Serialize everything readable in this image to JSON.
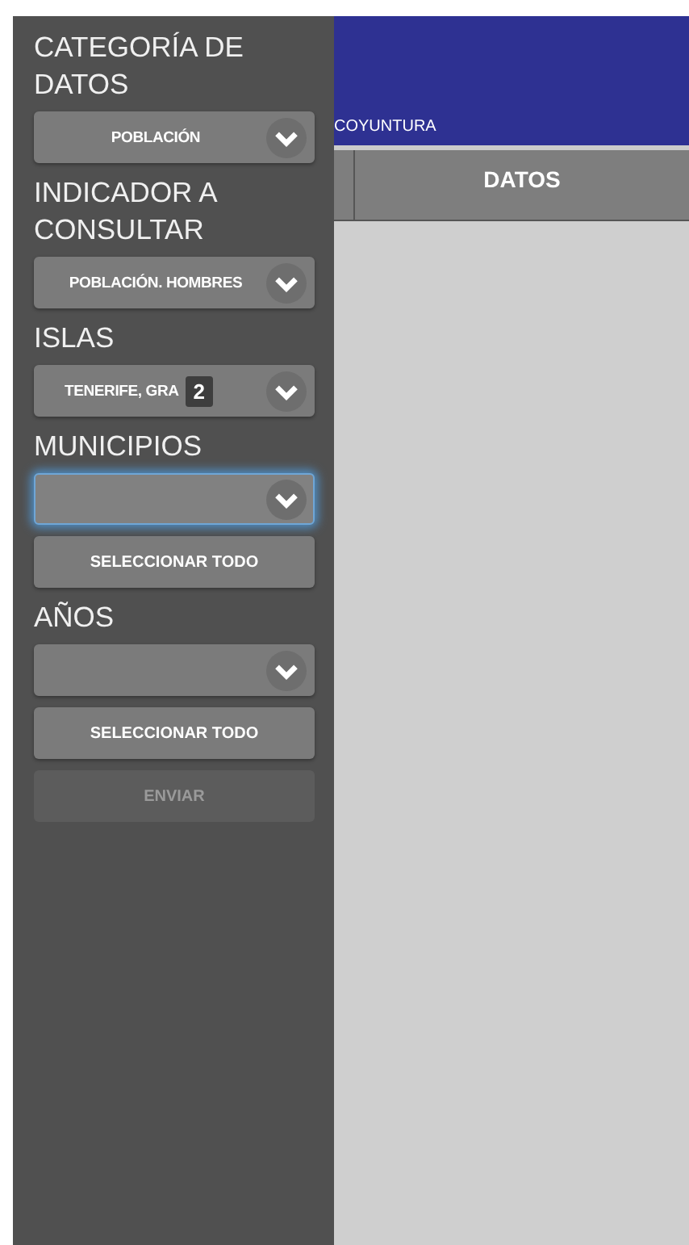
{
  "sidebar": {
    "items": [
      {
        "kind": "label",
        "text": "CATEGORÍA DE DATOS"
      },
      {
        "kind": "select",
        "value": "POBLACIÓN",
        "focused": false
      },
      {
        "kind": "label",
        "text": "INDICADOR A CONSULTAR"
      },
      {
        "kind": "select",
        "value": "POBLACIÓN. HOMBRES",
        "focused": false
      },
      {
        "kind": "label",
        "text": "ISLAS"
      },
      {
        "kind": "select",
        "value": "TENERIFE, GRA",
        "badge": "2",
        "focused": false
      },
      {
        "kind": "label",
        "text": "MUNICIPIOS"
      },
      {
        "kind": "select",
        "focused": true
      },
      {
        "kind": "button",
        "text": "SELECCIONAR TODO",
        "disabled": false
      },
      {
        "kind": "label",
        "text": "AÑOS"
      },
      {
        "kind": "select",
        "focused": false
      },
      {
        "kind": "button",
        "text": "SELECCIONAR TODO",
        "disabled": false
      },
      {
        "kind": "button",
        "text": "ENVIAR",
        "disabled": true
      }
    ]
  },
  "header": {
    "subtitle": "COYUNTURA"
  },
  "table": {
    "columns": [
      "DATOS"
    ]
  }
}
